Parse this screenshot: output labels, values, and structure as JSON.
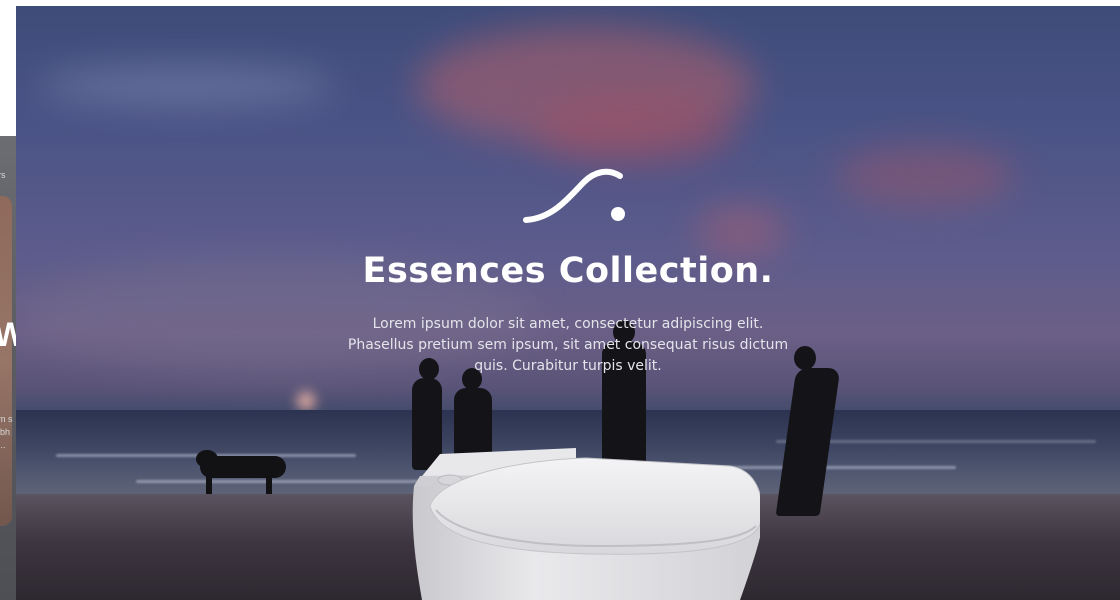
{
  "left_panel": {
    "text_fragments": [
      "rs",
      "m s",
      "ibh",
      "..."
    ],
    "big_letter": "W"
  },
  "hero": {
    "logo_icon": "swoosh-dot-logo-icon",
    "title": "Essences Collection.",
    "description_lines": [
      "Lorem ipsum dolor sit amet, consectetur adipiscing elit.",
      "Phasellus pretium sem ipsum, sit amet consequat risus dictum",
      "quis. Curabitur turpis velit."
    ],
    "product_image": "toilet-image"
  },
  "colors": {
    "title": "#ffffff",
    "description": "#e4e4ea",
    "sky_top": "#3e4c7a",
    "sky_mid": "#6b5f86",
    "cloud_accent": "#b5616a"
  }
}
